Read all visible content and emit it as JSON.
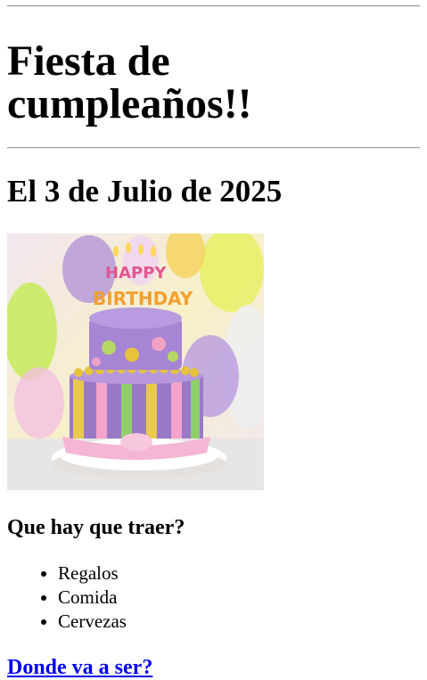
{
  "title": "Fiesta de cumpleaños!!",
  "date": "El 3 de Julio de 2025",
  "image": {
    "cake_text_top": "HAPPY",
    "cake_text_bottom": "BIRTHDAY"
  },
  "bring_heading": "Que hay que traer?",
  "items": [
    "Regalos",
    "Comida",
    "Cervezas"
  ],
  "location_link": "Donde va a ser?",
  "colors": {
    "link": "#0000ee",
    "rule": "#9a9a9a"
  }
}
